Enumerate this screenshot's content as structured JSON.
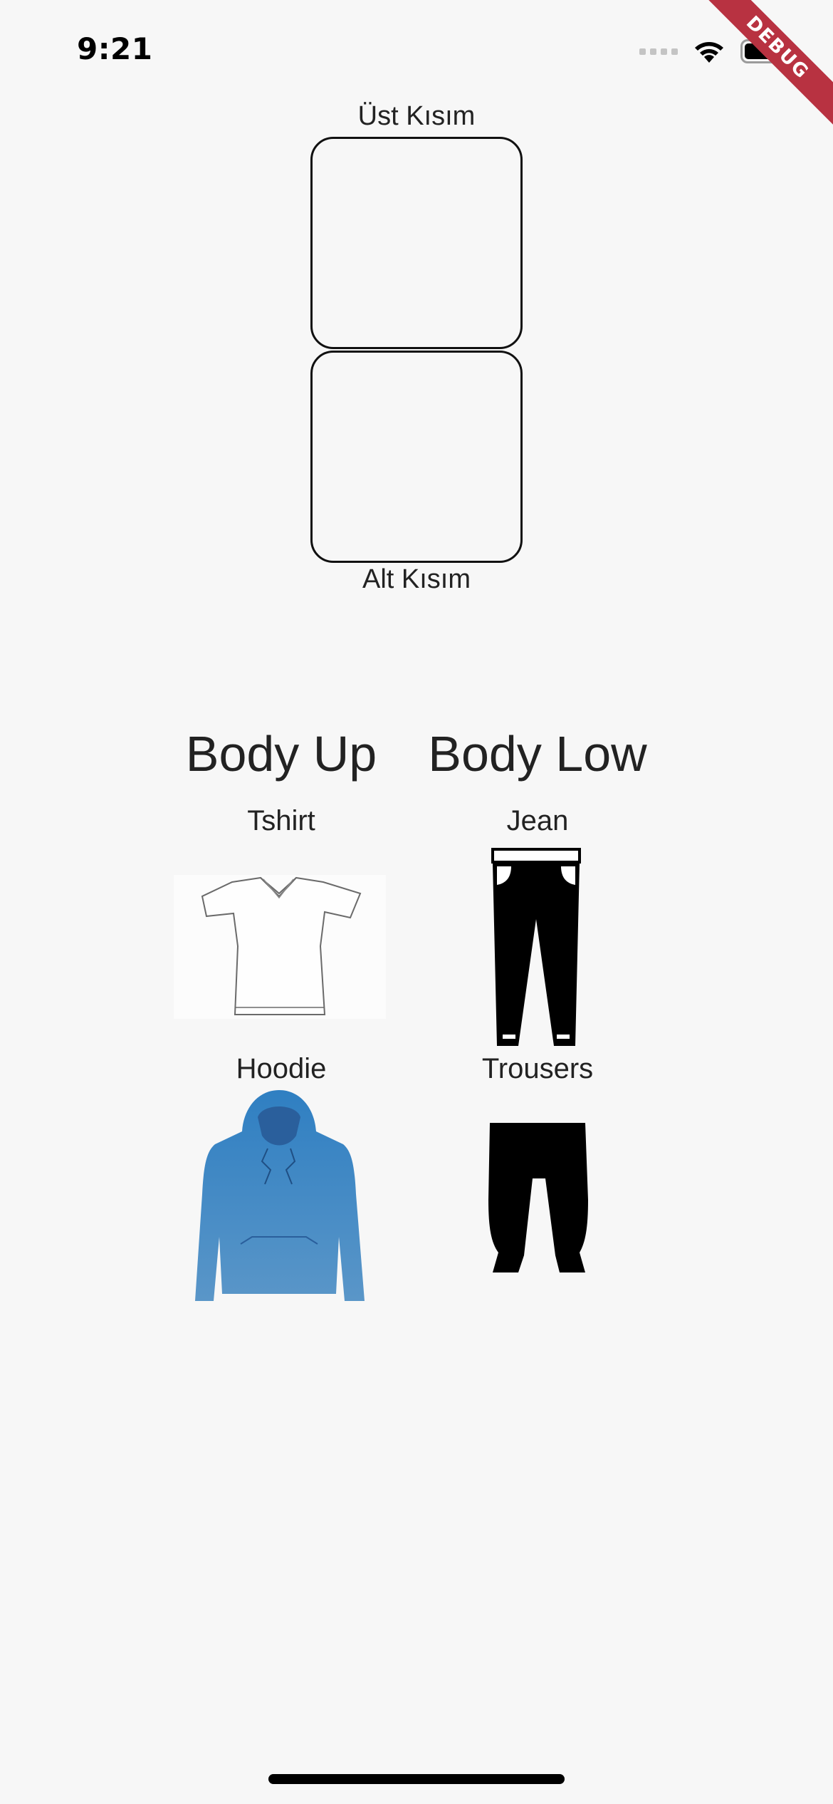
{
  "status_bar": {
    "time": "9:21"
  },
  "debug_banner": "DEBUG",
  "outfit": {
    "top_label": "Üst Kısım",
    "bottom_label": "Alt Kısım"
  },
  "categories": {
    "body_up": {
      "title": "Body Up",
      "items": [
        {
          "label": "Tshirt",
          "icon": "tshirt-icon"
        },
        {
          "label": "Hoodie",
          "icon": "hoodie-icon"
        }
      ]
    },
    "body_low": {
      "title": "Body Low",
      "items": [
        {
          "label": "Jean",
          "icon": "jean-icon"
        },
        {
          "label": "Trousers",
          "icon": "trousers-icon"
        }
      ]
    }
  },
  "colors": {
    "debug_red": "#b83241",
    "hoodie_blue": "#3d86c4",
    "background": "#f7f7f7"
  }
}
